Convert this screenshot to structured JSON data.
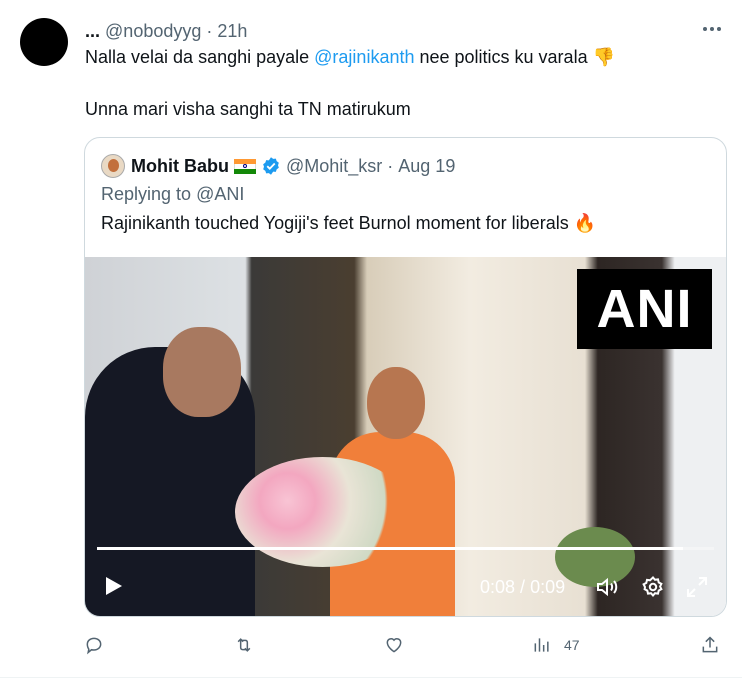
{
  "tweet": {
    "display_name": "...",
    "handle": "@nobodyyg",
    "separator": "·",
    "time": "21h",
    "line1_pre": "Nalla velai da sanghi payale ",
    "line1_mention": "@rajinikanth",
    "line1_post": " nee politics ku varala 👎",
    "line2": "Unna mari visha sanghi ta TN matirukum"
  },
  "quote": {
    "display_name": "Mohit Babu",
    "flag_emoji": "india-flag",
    "handle": "@Mohit_ksr",
    "separator": "·",
    "date": "Aug 19",
    "replying_prefix": "Replying to ",
    "replying_to": "@ANI",
    "text": "Rajinikanth touched Yogiji's feet Burnol moment for liberals 🔥"
  },
  "video": {
    "watermark": "ANI",
    "time_current": "0:08",
    "time_sep": " / ",
    "time_total": "0:09",
    "progress": 0.95
  },
  "actions": {
    "views_count": "47",
    "icons": [
      "reply-icon",
      "retweet-icon",
      "like-icon",
      "views-icon",
      "share-icon"
    ]
  },
  "colors": {
    "link": "#1d9bf0",
    "secondary_text": "#536471",
    "border": "#cfd9de"
  }
}
